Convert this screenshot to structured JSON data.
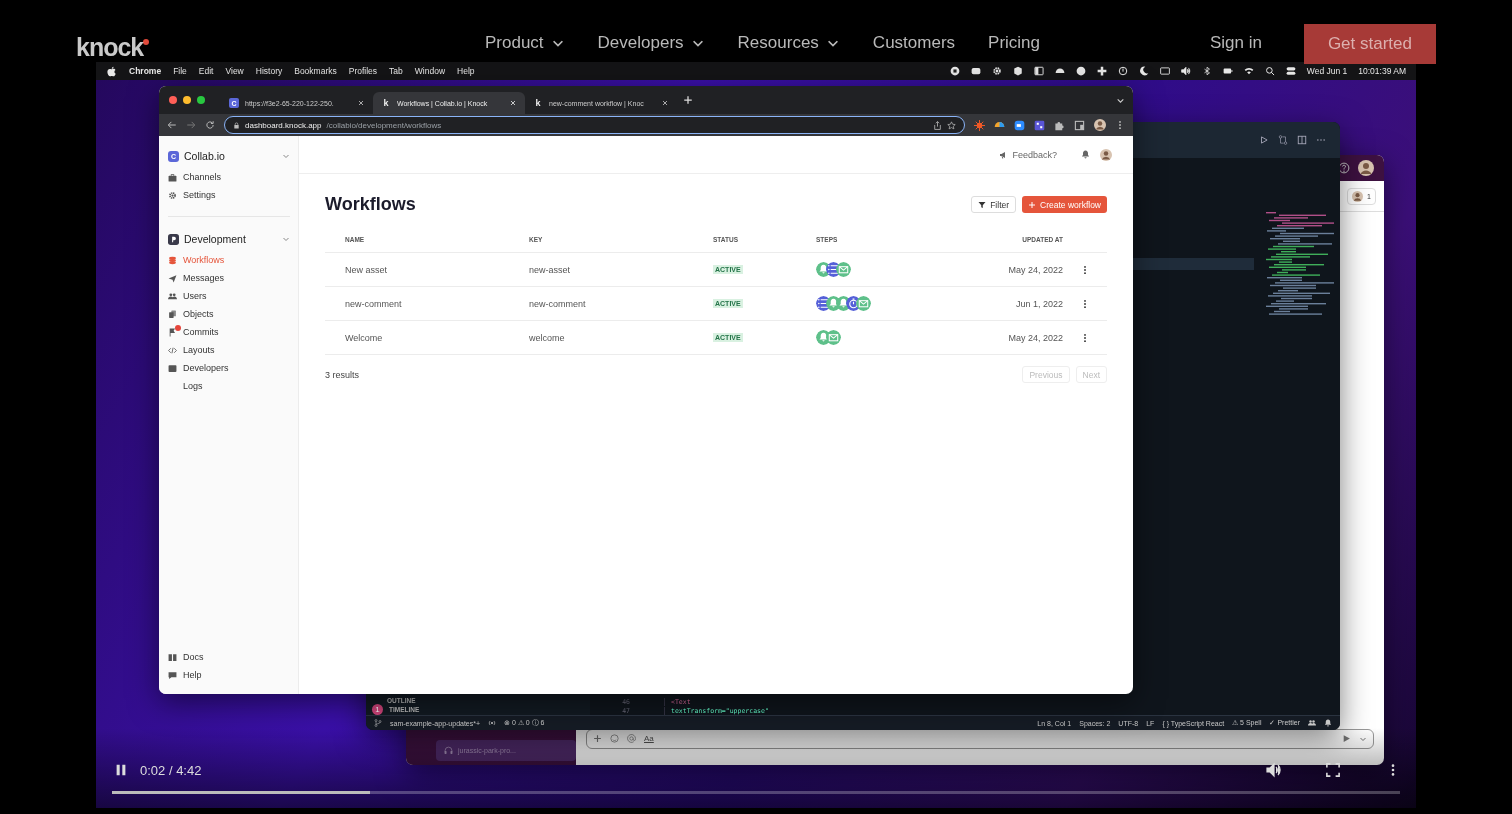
{
  "site_nav": {
    "logo": "knock",
    "links": [
      {
        "label": "Product",
        "dropdown": true
      },
      {
        "label": "Developers",
        "dropdown": true
      },
      {
        "label": "Resources",
        "dropdown": true
      },
      {
        "label": "Customers",
        "dropdown": false
      },
      {
        "label": "Pricing",
        "dropdown": false
      }
    ],
    "sign_in": "Sign in",
    "cta": "Get started"
  },
  "video": {
    "menu_bar": {
      "app": "Chrome",
      "menus": [
        "File",
        "Edit",
        "View",
        "History",
        "Bookmarks",
        "Profiles",
        "Tab",
        "Window",
        "Help"
      ],
      "date": "Wed Jun 1",
      "time": "10:01:39 AM"
    },
    "browser": {
      "tabs": [
        {
          "favicon": "C",
          "title": "https://f3e2-65-220-122-250.",
          "selected": false
        },
        {
          "favicon": "k",
          "title": "Workflows | Collab.io | Knock",
          "selected": true
        },
        {
          "favicon": "k",
          "title": "new-comment workflow | Knoc",
          "selected": false
        }
      ],
      "url_host": "dashboard.knock.app",
      "url_path": "/collabio/development/workflows"
    },
    "dashboard": {
      "sidebar": {
        "workspace": {
          "badge": "C",
          "name": "Collab.io"
        },
        "workspace_items": [
          {
            "label": "Channels",
            "selected": false
          },
          {
            "label": "Settings",
            "selected": false
          }
        ],
        "environment": {
          "name": "Development"
        },
        "items": [
          {
            "label": "Workflows",
            "selected": true,
            "notification": false
          },
          {
            "label": "Messages",
            "selected": false,
            "notification": false
          },
          {
            "label": "Users",
            "selected": false,
            "notification": false
          },
          {
            "label": "Objects",
            "selected": false,
            "notification": false
          },
          {
            "label": "Commits",
            "selected": false,
            "notification": true
          },
          {
            "label": "Layouts",
            "selected": false,
            "notification": false
          },
          {
            "label": "Developers",
            "selected": false,
            "notification": false
          },
          {
            "label": "Logs",
            "selected": false,
            "notification": false
          }
        ],
        "footer_items": [
          {
            "label": "Docs",
            "selected": false
          },
          {
            "label": "Help",
            "selected": false
          }
        ]
      },
      "feedback": "Feedback?",
      "title": "Workflows",
      "filter": "Filter",
      "create": "Create workflow",
      "table": {
        "columns": [
          "NAME",
          "KEY",
          "STATUS",
          "STEPS",
          "UPDATED AT"
        ],
        "rows": [
          {
            "name": "New asset",
            "key": "new-asset",
            "status": "ACTIVE",
            "steps": [
              {
                "kind": "inapp"
              },
              {
                "kind": "batch"
              },
              {
                "kind": "email"
              }
            ],
            "updated": "May 24, 2022"
          },
          {
            "name": "new-comment",
            "key": "new-comment",
            "status": "ACTIVE",
            "steps": [
              {
                "kind": "batch"
              },
              {
                "kind": "inapp"
              },
              {
                "kind": "inapp"
              },
              {
                "kind": "delay"
              },
              {
                "kind": "email"
              }
            ],
            "updated": "Jun 1, 2022"
          },
          {
            "name": "Welcome",
            "key": "welcome",
            "status": "ACTIVE",
            "steps": [
              {
                "kind": "inapp"
              },
              {
                "kind": "email"
              }
            ],
            "updated": "May 24, 2022"
          }
        ]
      },
      "results": "3 results",
      "previous": {
        "label": "Previous",
        "disabled": true
      },
      "next": {
        "label": "Next",
        "disabled": true
      }
    },
    "editor": {
      "panels": [
        "OUTLINE",
        "TIMELINE"
      ],
      "accounts_badge": "1",
      "lines": [
        {
          "number": "46",
          "code": "<Text"
        },
        {
          "number": "47",
          "code": "textTransform=\"uppercase\""
        }
      ],
      "status_bar": {
        "branch": "sam-example-app-updates*+",
        "problems": "⊗ 0 ⚠ 0 ⓘ 6",
        "items": [
          "Ln 8, Col 1",
          "Spaces: 2",
          "UTF-8",
          "LF",
          "{ } TypeScript React",
          "⚠ 5 Spell",
          "✓ Prettier"
        ]
      }
    },
    "chat": {
      "member_count": "1",
      "channel": "jurassic-park-pro...",
      "format_label": "Aa"
    },
    "player": {
      "playing": true,
      "time": "0:02 / 4:42",
      "level": 0.2
    }
  }
}
